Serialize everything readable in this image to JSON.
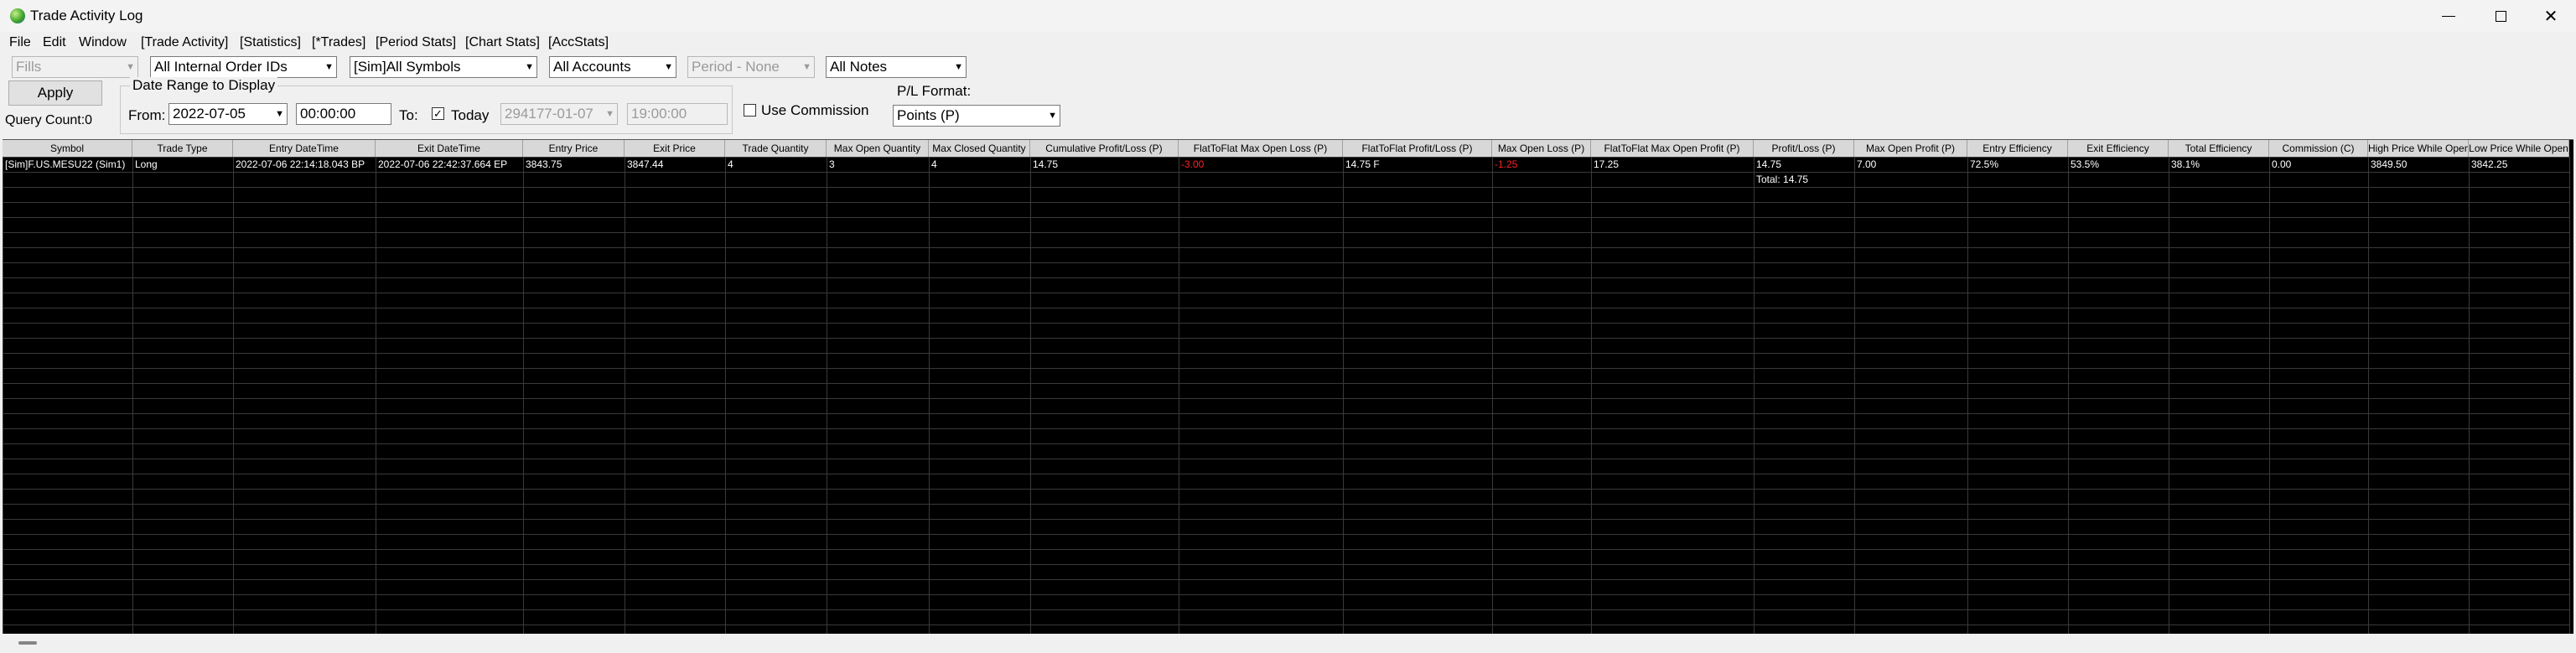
{
  "window": {
    "title": "Trade Activity Log"
  },
  "menu": [
    "File",
    "Edit",
    "Window",
    "[Trade Activity]",
    "[Statistics]",
    "[*Trades]",
    "[Period Stats]",
    "[Chart Stats]",
    "[AccStats]"
  ],
  "toolbar": {
    "fills": "Fills",
    "order_ids": "All Internal Order IDs",
    "symbols": "[Sim]All Symbols",
    "accounts": "All Accounts",
    "period": "Period - None",
    "notes": "All Notes",
    "apply_label": "Apply",
    "query_count": "Query Count:0",
    "date_range_label": "Date Range to Display",
    "from_label": "From:",
    "from_date": "2022-07-05",
    "from_time": "00:00:00",
    "to_label": "To:",
    "today_check": "✓",
    "today_label": "Today",
    "to_date": "294177-01-07",
    "to_time": "19:00:00",
    "use_commission_label": "Use Commission",
    "pl_format_label": "P/L Format:",
    "pl_format": "Points (P)"
  },
  "table": {
    "columns": [
      "Symbol",
      "Trade Type",
      "Entry DateTime",
      "Exit DateTime",
      "Entry Price",
      "Exit Price",
      "Trade Quantity",
      "Max Open Quantity",
      "Max Closed Quantity",
      "Cumulative Profit/Loss (P)",
      "FlatToFlat Max Open Loss (P)",
      "FlatToFlat Profit/Loss (P)",
      "Max Open Loss (P)",
      "FlatToFlat Max Open Profit (P)",
      "Profit/Loss (P)",
      "Max Open Profit (P)",
      "Entry Efficiency",
      "Exit Efficiency",
      "Total Efficiency",
      "Commission (C)",
      "High Price While Open",
      "Low Price While Open"
    ],
    "rows": [
      [
        "[Sim]F.US.MESU22 (Sim1)",
        "Long",
        "2022-07-06  22:14:18.043 BP",
        "2022-07-06  22:42:37.664 EP",
        "3843.75",
        "3847.44",
        "4",
        "3",
        "4",
        "14.75",
        "-3.00",
        "14.75 F",
        "-1.25",
        "17.25",
        "14.75",
        "7.00",
        "72.5%",
        "53.5%",
        "38.1%",
        "0.00",
        "3849.50",
        "3842.25"
      ]
    ],
    "total_label": "Total: 14.75"
  },
  "colors": {
    "grid_bg": "#000000",
    "grid_text": "#ffffff",
    "negative": "#ff2020",
    "header_bg": "#d8d8d8"
  }
}
